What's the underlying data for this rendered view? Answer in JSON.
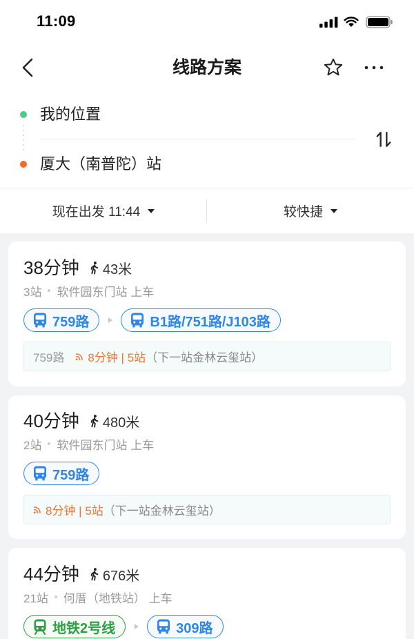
{
  "status_bar": {
    "time": "11:09",
    "icons": [
      "cellular-signal-icon",
      "wifi-icon",
      "battery-icon"
    ]
  },
  "header": {
    "title": "线路方案",
    "back_icon": "chevron-left-icon",
    "favorite_icon": "star-icon",
    "more_icon": "more-icon"
  },
  "route": {
    "origin": "我的位置",
    "destination": "厦大（南普陀）站",
    "swap_icon": "swap-icon"
  },
  "filters": {
    "depart_time": "现在出发 11:44",
    "preference": "较快捷",
    "caret_icon": "caret-down-icon"
  },
  "colors": {
    "bus_blue": "#2f86e6",
    "subway_green": "#2f9d46",
    "realtime_orange": "#f07432",
    "origin_dot": "#4ccb8c",
    "destination_dot": "#f26b2a",
    "page_background": "#f2f3f5"
  },
  "plans": [
    {
      "duration": "38分钟",
      "walk_icon": "walking-icon",
      "walk_distance": "43米",
      "stops": "3站",
      "boarding": "软件园东门站 上车",
      "legs": [
        {
          "icon": "bus-icon",
          "label": "759路"
        },
        {
          "icon": "bus-icon",
          "label": "B1路/751路/J103路"
        }
      ],
      "realtime": {
        "line": "759路",
        "icon": "realtime-signal-icon",
        "eta": "8分钟 | 5站",
        "next_stop": "（下一站金林云玺站）"
      }
    },
    {
      "duration": "40分钟",
      "walk_icon": "walking-icon",
      "walk_distance": "480米",
      "stops": "2站",
      "boarding": "软件园东门站 上车",
      "legs": [
        {
          "icon": "bus-icon",
          "label": "759路"
        }
      ],
      "realtime": {
        "icon": "realtime-signal-icon",
        "eta": "8分钟 | 5站",
        "next_stop": "（下一站金林云玺站）"
      }
    },
    {
      "duration": "44分钟",
      "walk_icon": "walking-icon",
      "walk_distance": "676米",
      "stops": "21站",
      "boarding": "何厝（地铁站） 上车",
      "legs": [
        {
          "icon": "subway-icon",
          "label": "地铁2号线"
        },
        {
          "icon": "bus-icon",
          "label": "309路"
        }
      ]
    }
  ]
}
